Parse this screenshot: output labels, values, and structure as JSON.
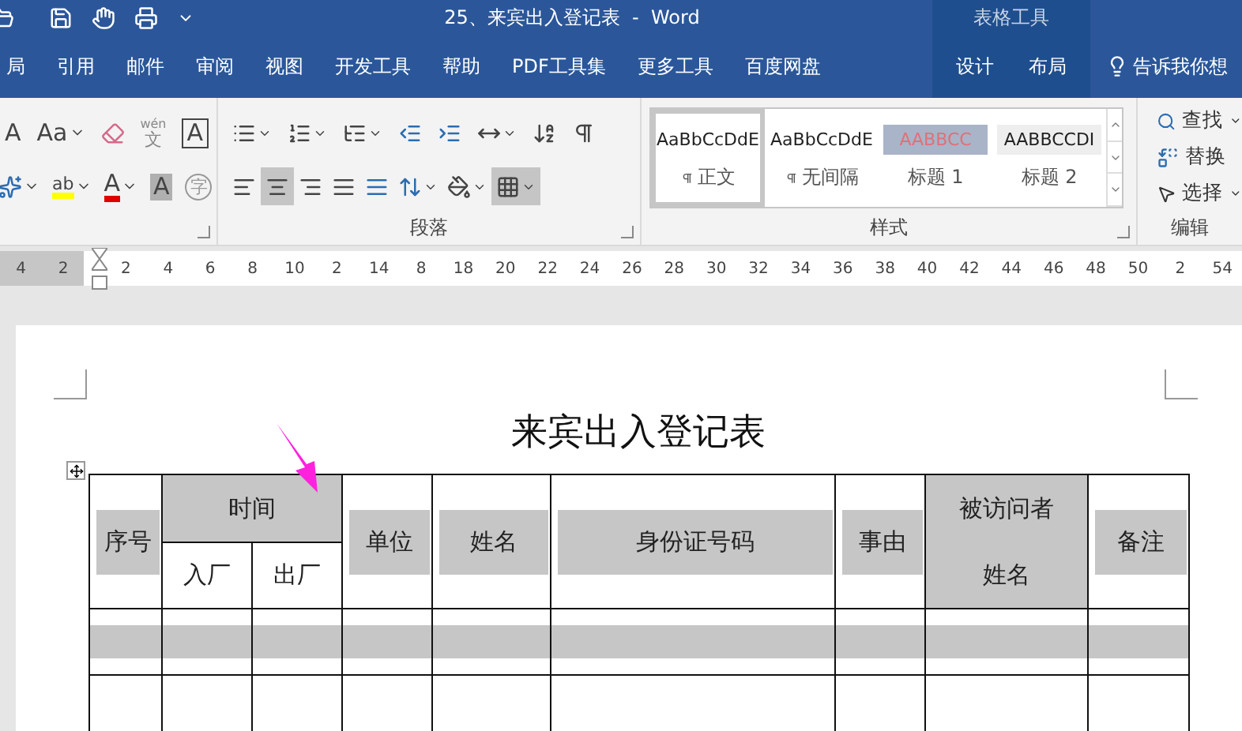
{
  "title_bar": {
    "title": "25、来宾出入登记表  -  Word",
    "context_label": "表格工具"
  },
  "ribbon_tabs": [
    {
      "label": "局",
      "contextual": false
    },
    {
      "label": "引用",
      "contextual": false
    },
    {
      "label": "邮件",
      "contextual": false
    },
    {
      "label": "审阅",
      "contextual": false
    },
    {
      "label": "视图",
      "contextual": false
    },
    {
      "label": "开发工具",
      "contextual": false
    },
    {
      "label": "帮助",
      "contextual": false
    },
    {
      "label": "PDF工具集",
      "contextual": false
    },
    {
      "label": "更多工具",
      "contextual": false
    },
    {
      "label": "百度网盘",
      "contextual": false
    },
    {
      "label": "设计",
      "contextual": true
    },
    {
      "label": "布局",
      "contextual": true
    }
  ],
  "tell_me": {
    "placeholder": "告诉我你想"
  },
  "font_group": {
    "row1": [
      {
        "kind": "grow-font",
        "text": "A"
      },
      {
        "kind": "change-case",
        "text": "Aa"
      },
      {
        "kind": "clear-format"
      },
      {
        "kind": "phonetic",
        "text": "wén",
        "sub": "文"
      },
      {
        "kind": "char-border",
        "text": "A"
      }
    ],
    "row2": [
      {
        "kind": "text-effect"
      },
      {
        "kind": "highlight",
        "text": "ab"
      },
      {
        "kind": "font-color",
        "text": "A"
      },
      {
        "kind": "char-shading",
        "text": "A"
      },
      {
        "kind": "enclose",
        "text": "字"
      }
    ]
  },
  "paragraph_group": {
    "label": "段落",
    "row1": [
      {
        "kind": "bullets",
        "selected": false
      },
      {
        "kind": "numbering",
        "selected": false
      },
      {
        "kind": "multilevel",
        "selected": false
      },
      {
        "kind": "decrease-indent",
        "selected": false
      },
      {
        "kind": "increase-indent",
        "selected": false
      },
      {
        "kind": "asian-layout",
        "selected": false
      },
      {
        "kind": "sort",
        "selected": false
      },
      {
        "kind": "show-marks",
        "selected": false
      }
    ],
    "row2": [
      {
        "kind": "align-left",
        "selected": false
      },
      {
        "kind": "align-center",
        "selected": true
      },
      {
        "kind": "align-right",
        "selected": false
      },
      {
        "kind": "justify",
        "selected": false
      },
      {
        "kind": "distributed",
        "selected": false
      },
      {
        "kind": "line-spacing",
        "selected": false
      },
      {
        "kind": "shading",
        "selected": false
      },
      {
        "kind": "borders",
        "selected": true
      }
    ]
  },
  "styles_group": {
    "label": "样式",
    "items": [
      {
        "sample": "AaBbCcDdE",
        "name": "正文",
        "kind": "normal",
        "linked": true,
        "selected": true
      },
      {
        "sample": "AaBbCcDdE",
        "name": "无间隔",
        "kind": "normal",
        "linked": true,
        "selected": false
      },
      {
        "sample": "AABBCC",
        "name": "标题 1",
        "kind": "heading1",
        "linked": false,
        "selected": false
      },
      {
        "sample": "AABBCCDI",
        "name": "标题 2",
        "kind": "heading2",
        "linked": false,
        "selected": false
      }
    ]
  },
  "editing_group": {
    "label": "编辑",
    "items": [
      {
        "kind": "find",
        "label": "查找",
        "dropdown": true
      },
      {
        "kind": "replace",
        "label": "替换",
        "dropdown": false
      },
      {
        "kind": "select",
        "label": "选择",
        "dropdown": true
      }
    ]
  },
  "ruler": {
    "left_numbers": [
      "4",
      "2"
    ],
    "numbers": [
      "2",
      "4",
      "6",
      "8",
      "10",
      "2",
      "14",
      "8",
      "18",
      "20",
      "22",
      "24",
      "26",
      "28",
      "30",
      "32",
      "34",
      "36",
      "38",
      "40",
      "42",
      "44",
      "46",
      "48",
      "50",
      "2",
      "54"
    ]
  },
  "document": {
    "heading": "来宾出入登记表",
    "table": {
      "header": [
        {
          "paragraphs": [
            "序号"
          ],
          "kind": "band"
        },
        {
          "paragraphs": [
            "时间"
          ],
          "kind": "full",
          "children": [
            {
              "text": "入厂"
            },
            {
              "text": "出厂"
            }
          ]
        },
        {
          "paragraphs": [
            "单位"
          ],
          "kind": "band"
        },
        {
          "paragraphs": [
            "姓名"
          ],
          "kind": "band"
        },
        {
          "paragraphs": [
            "身份证号码"
          ],
          "kind": "band"
        },
        {
          "paragraphs": [
            "事由"
          ],
          "kind": "band"
        },
        {
          "paragraphs": [
            "被访问者",
            "姓名"
          ],
          "kind": "full"
        },
        {
          "paragraphs": [
            "备注"
          ],
          "kind": "band"
        }
      ],
      "rows": [
        {
          "shaded": true
        },
        {
          "shaded": false
        }
      ]
    }
  }
}
